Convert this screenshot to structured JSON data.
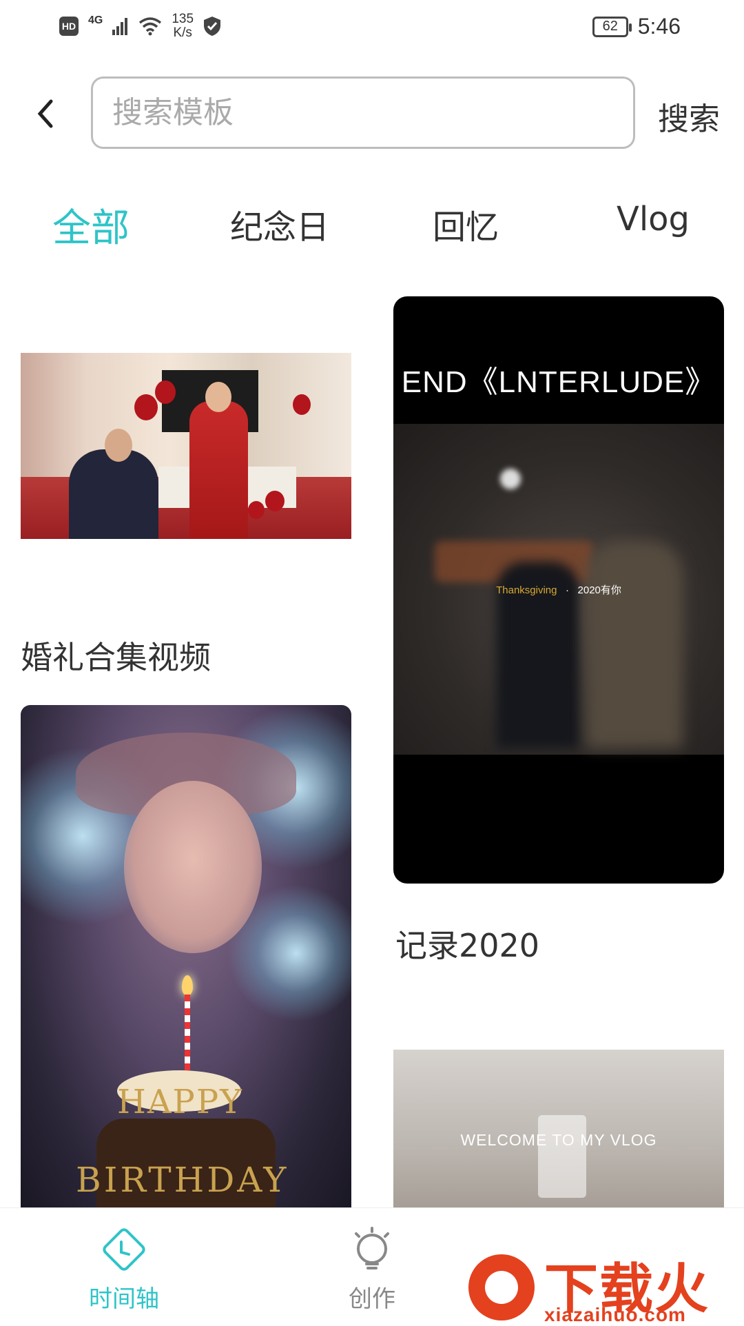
{
  "status_bar": {
    "hd": "HD",
    "network": "4G",
    "speed_value": "135",
    "speed_unit": "K/s",
    "battery": "62",
    "time": "5:46"
  },
  "search": {
    "placeholder": "搜索模板",
    "button": "搜索"
  },
  "tabs": [
    {
      "label": "全部",
      "active": true
    },
    {
      "label": "纪念日",
      "active": false
    },
    {
      "label": "回忆",
      "active": false
    },
    {
      "label": "Vlog",
      "active": false
    }
  ],
  "cards": {
    "wedding": {
      "title": "婚礼合集视频"
    },
    "interlude": {
      "title": "记录2020",
      "overlay_title": "END《LNTERLUDE》",
      "caption_gold": "Thanksgiving",
      "caption_sep": "·",
      "caption_white": "2020有你"
    },
    "birthday": {
      "letters_top": "HAPPY",
      "letters_bottom": "BIRTHDAY"
    },
    "vlog": {
      "overlay_title": "WELCOME TO MY VLOG"
    }
  },
  "bottom_nav": [
    {
      "label": "时间轴",
      "icon": "timeline-icon",
      "active": true
    },
    {
      "label": "创作",
      "icon": "create-icon",
      "active": false
    }
  ],
  "watermark": {
    "text": "下载火",
    "url": "xiazaihuo.com"
  },
  "colors": {
    "accent": "#2ec4c8",
    "watermark": "#e4411e"
  }
}
